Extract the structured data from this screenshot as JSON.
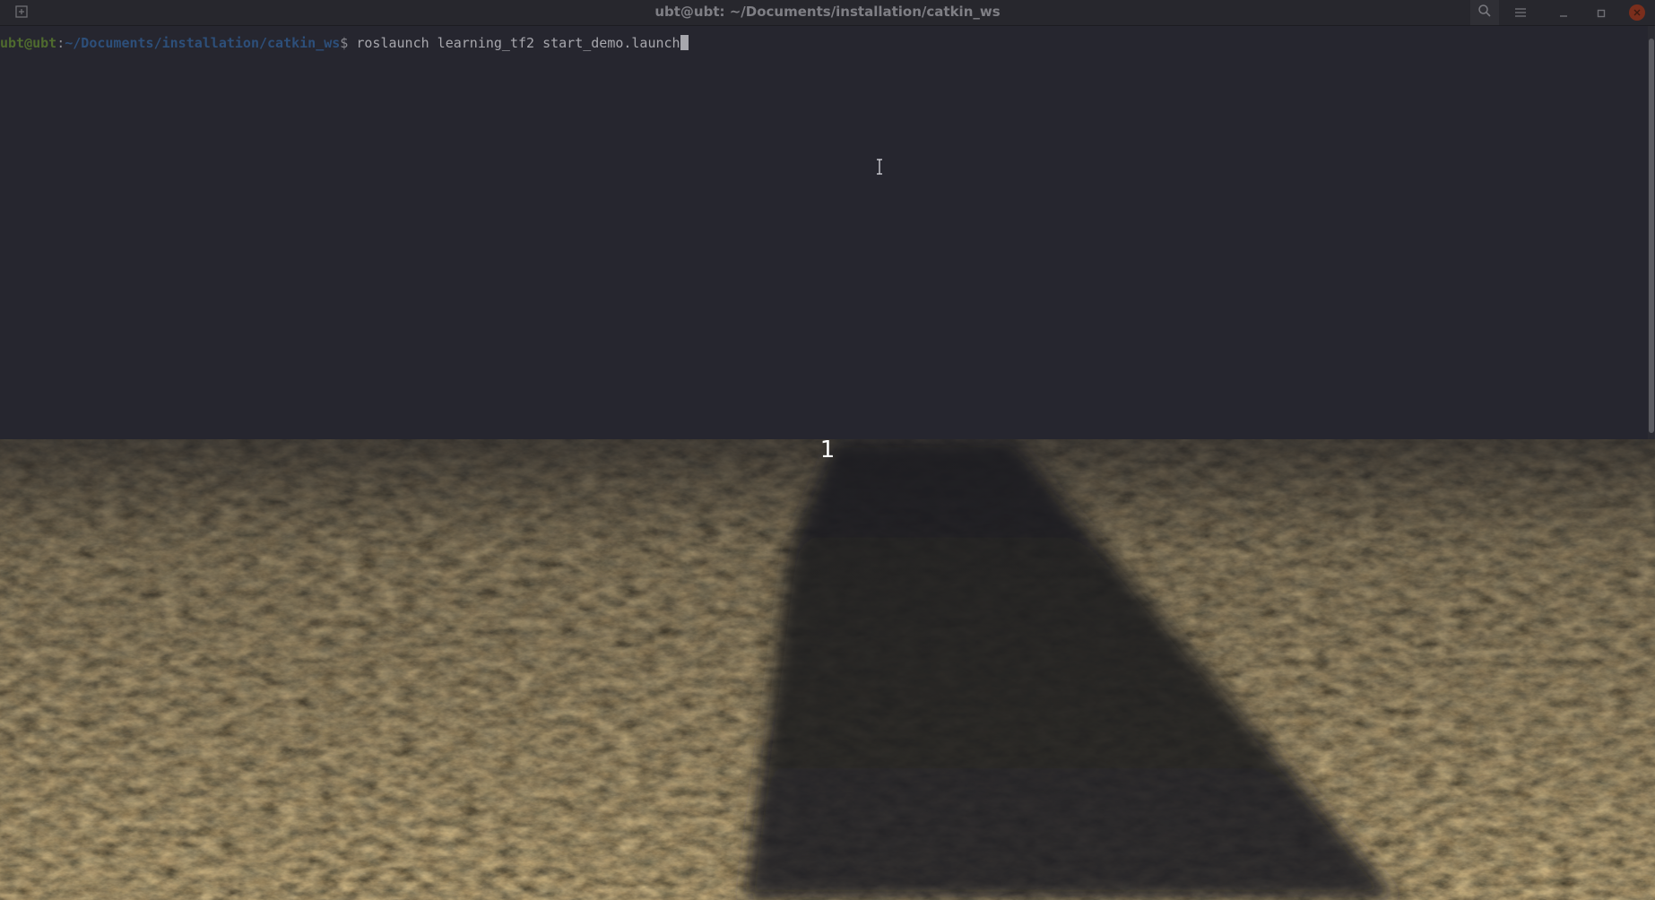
{
  "window": {
    "title": "ubt@ubt: ~/Documents/installation/catkin_ws",
    "buttons": {
      "new_tab": "new-tab-icon",
      "search": "search-icon",
      "menu": "hamburger-menu-icon",
      "minimize": "minimize-icon",
      "maximize": "maximize-icon",
      "close": "close-icon"
    }
  },
  "terminal": {
    "prompt_user": "ubt@ubt",
    "prompt_colon": ":",
    "prompt_path": "~/Documents/installation/catkin_ws",
    "prompt_symbol": "$ ",
    "command": "roslaunch learning_tf2 start_demo.launch"
  },
  "overlay": {
    "number": "1"
  },
  "colors": {
    "terminal_bg": "#26262f",
    "titlebar_bg": "#27272d",
    "prompt_user": "#4f6b2e",
    "prompt_path": "#2d4f7a",
    "command_text": "#a7a7ad",
    "close_button": "#7a2e1c"
  }
}
